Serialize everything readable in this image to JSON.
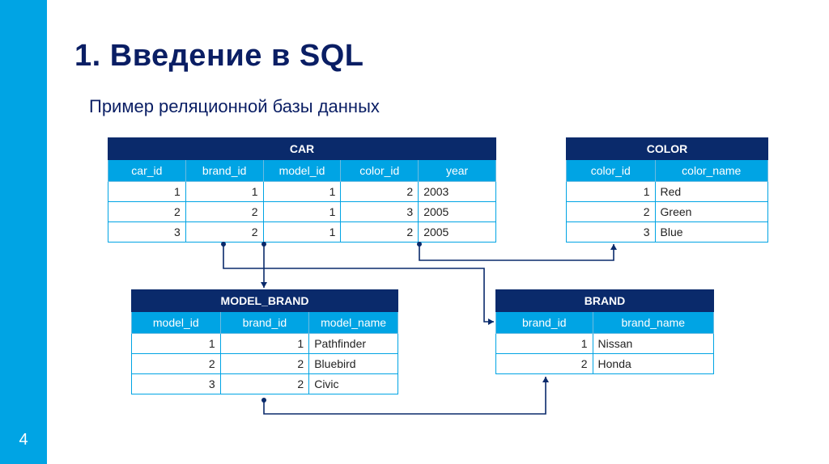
{
  "page_number": "4",
  "heading": "1. Введение в SQL",
  "subheading": "Пример реляционной базы данных",
  "tables": {
    "car": {
      "title": "CAR",
      "columns": [
        "car_id",
        "brand_id",
        "model_id",
        "color_id",
        "year"
      ],
      "rows": [
        [
          "1",
          "1",
          "1",
          "2",
          "2003"
        ],
        [
          "2",
          "2",
          "1",
          "3",
          "2005"
        ],
        [
          "3",
          "2",
          "1",
          "2",
          "2005"
        ]
      ]
    },
    "color": {
      "title": "COLOR",
      "columns": [
        "color_id",
        "color_name"
      ],
      "rows": [
        [
          "1",
          "Red"
        ],
        [
          "2",
          "Green"
        ],
        [
          "3",
          "Blue"
        ]
      ]
    },
    "model_brand": {
      "title": "MODEL_BRAND",
      "columns": [
        "model_id",
        "brand_id",
        "model_name"
      ],
      "rows": [
        [
          "1",
          "1",
          "Pathfinder"
        ],
        [
          "2",
          "2",
          "Bluebird"
        ],
        [
          "3",
          "2",
          "Civic"
        ]
      ]
    },
    "brand": {
      "title": "BRAND",
      "columns": [
        "brand_id",
        "brand_name"
      ],
      "rows": [
        [
          "1",
          "Nissan"
        ],
        [
          "2",
          "Honda"
        ]
      ]
    }
  }
}
